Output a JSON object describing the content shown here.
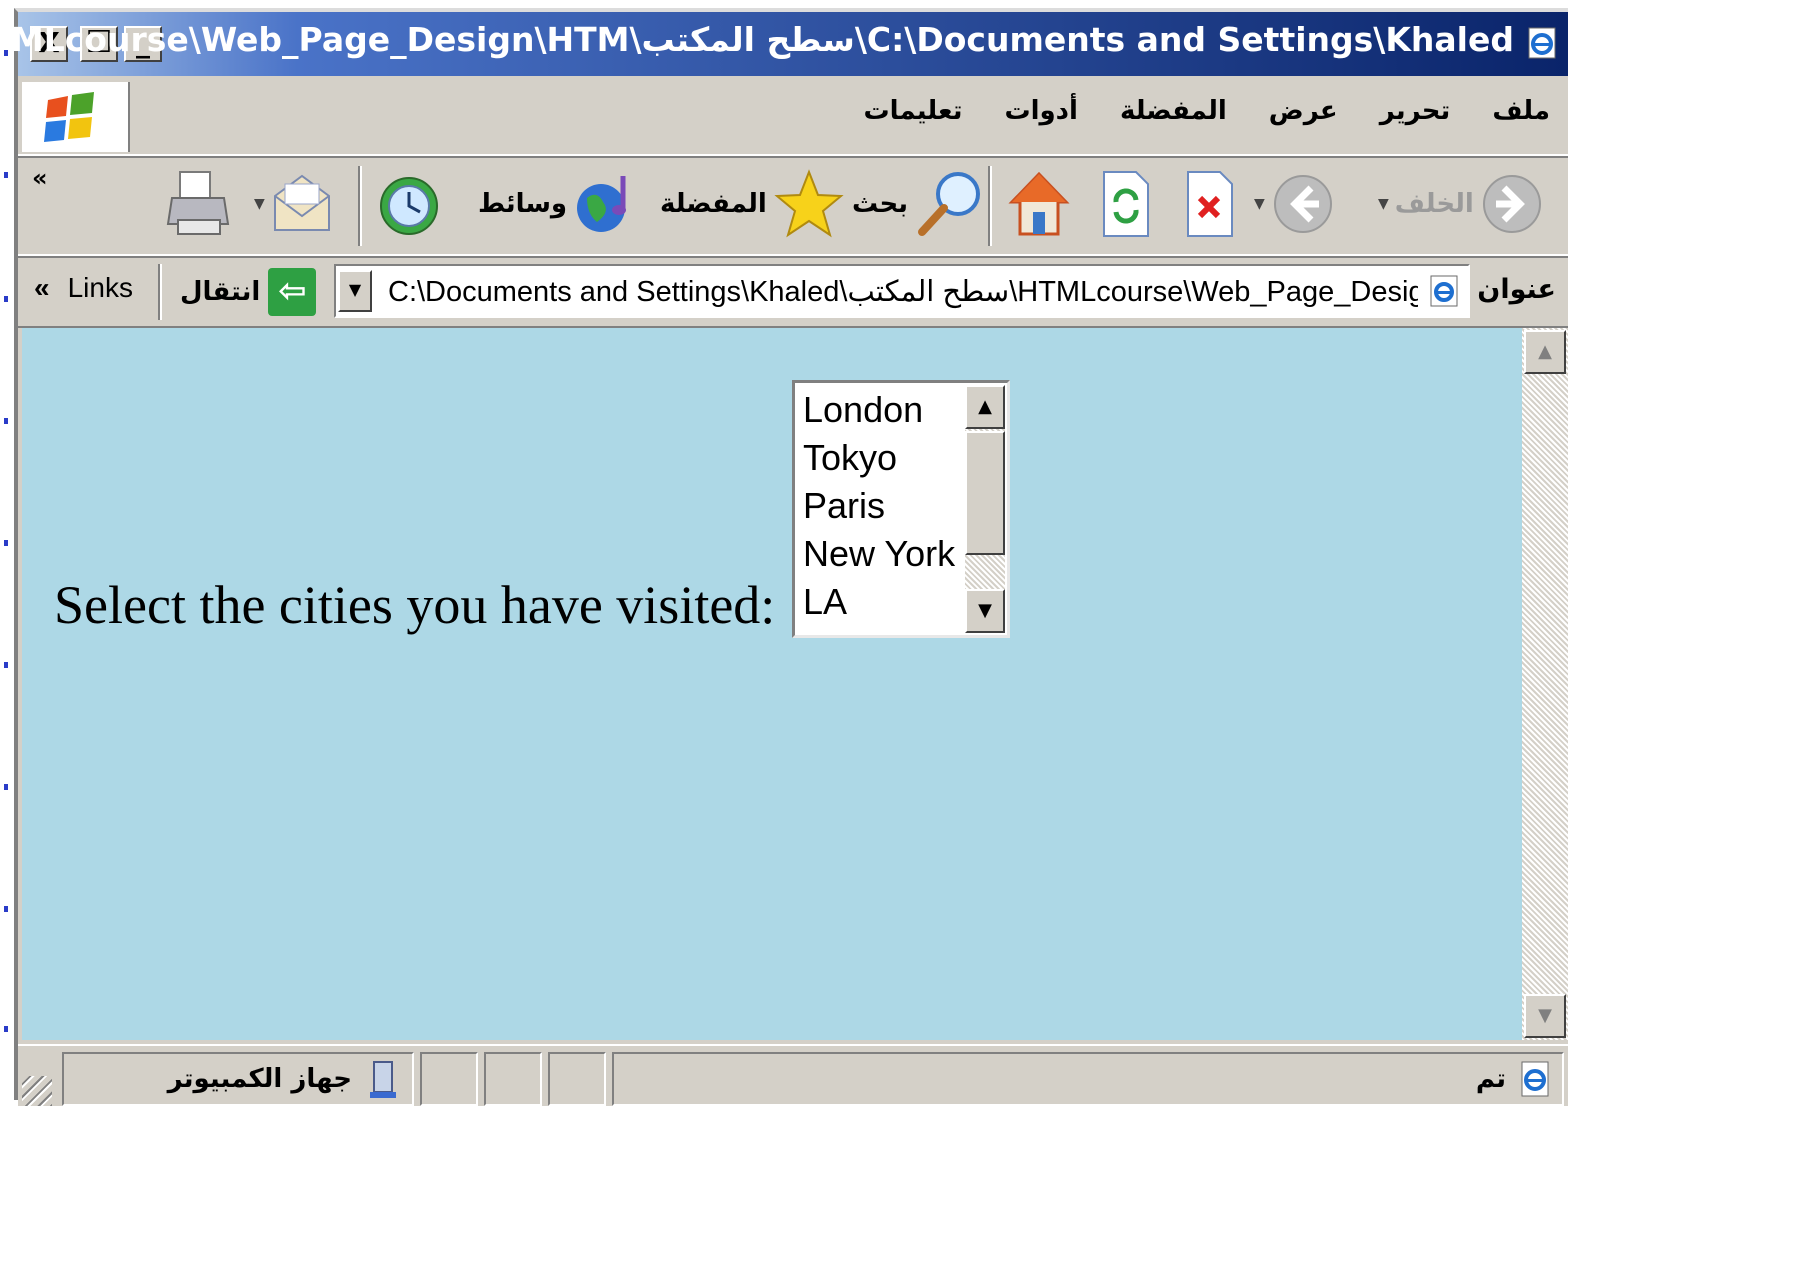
{
  "window": {
    "title": "...HTMLcourse\\Web_Page_Design\\HTM\\سطح المكتب\\C:\\Documents and Settings\\Khaled",
    "close_glyph": "X",
    "maximize_glyph": "☐",
    "minimize_glyph": "_"
  },
  "menu": {
    "items": [
      "ملف",
      "تحرير",
      "عرض",
      "المفضلة",
      "أدوات",
      "تعليمات"
    ]
  },
  "toolbar": {
    "back_label": "الخلف",
    "search_label": "بحث",
    "favorites_label": "المفضلة",
    "media_label": "وسائط",
    "more_glyph": "«"
  },
  "address": {
    "label": "عنوان",
    "url": "C:\\Documents and Settings\\Khaled\\سطح المكتب\\HTMLcourse\\Web_Page_Desig",
    "go_label": "انتقال",
    "links_label": "Links",
    "links_chevron": "«"
  },
  "page": {
    "prompt": "Select the cities you have visited:",
    "cities": [
      "London",
      "Tokyo",
      "Paris",
      "New York",
      "LA"
    ],
    "background": "#add8e6"
  },
  "status": {
    "left_text": "تم",
    "zone_text": "جهاز الكمبيوتر"
  },
  "colors": {
    "title_gradient_start": "#a8c4e8",
    "title_gradient_end": "#0a246a",
    "chrome": "#d4d0c8"
  }
}
